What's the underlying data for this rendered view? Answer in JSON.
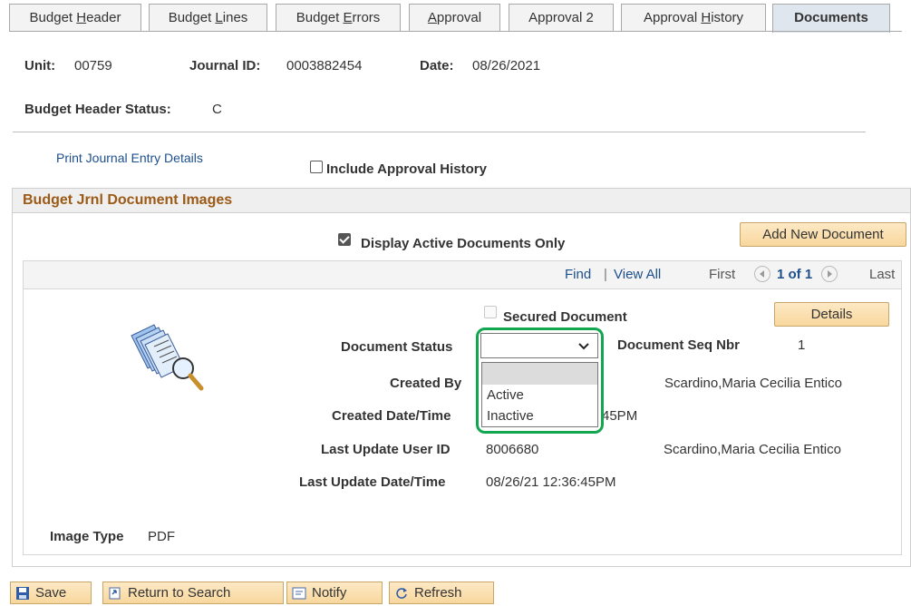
{
  "tabs": [
    {
      "label": "Budget Header",
      "key": "H"
    },
    {
      "label": "Budget Lines",
      "key": "L"
    },
    {
      "label": "Budget Errors",
      "key": "E"
    },
    {
      "label": "Approval",
      "key": "A"
    },
    {
      "label": "Approval 2",
      "key": ""
    },
    {
      "label": "Approval History",
      "key": "H"
    },
    {
      "label": "Documents",
      "key": ""
    }
  ],
  "header": {
    "unit_label": "Unit:",
    "unit_value": "00759",
    "journal_label": "Journal ID:",
    "journal_value": "0003882454",
    "date_label": "Date:",
    "date_value": "08/26/2021",
    "status_label": "Budget Header Status:",
    "status_value": "C"
  },
  "print_link": "Print Journal Entry Details",
  "include_approval_history": "Include Approval History",
  "panel_title": "Budget Jrnl Document Images",
  "display_active_only": "Display Active Documents Only",
  "add_new_document": "Add New Document",
  "grid_nav": {
    "find": "Find",
    "sep": "|",
    "view_all": "View All",
    "first": "First",
    "count": "1 of 1",
    "last": "Last"
  },
  "secured_document": "Secured Document",
  "details_button": "Details",
  "document_status": {
    "label": "Document Status",
    "value": "",
    "options": [
      "",
      "Active",
      "Inactive"
    ]
  },
  "document_seq": {
    "label": "Document Seq Nbr",
    "value": "1"
  },
  "created_by": {
    "label": "Created By",
    "name": "Scardino,Maria Cecilia Entico"
  },
  "created_datetime": {
    "label": "Created Date/Time",
    "value_tail": "45PM"
  },
  "last_update_user": {
    "label": "Last Update User ID",
    "value": "8006680",
    "name": "Scardino,Maria Cecilia Entico"
  },
  "last_update_datetime": {
    "label": "Last Update Date/Time",
    "value": "08/26/21 12:36:45PM"
  },
  "image_type": {
    "label": "Image Type",
    "value": "PDF"
  },
  "toolbar": {
    "save": "Save",
    "return_to_search": "Return to Search",
    "notify": "Notify",
    "refresh": "Refresh"
  },
  "colors": {
    "accent_green": "#13a651",
    "panel_title": "#9c5a17",
    "link": "#1c4f8c",
    "button": "#f8d79d"
  }
}
